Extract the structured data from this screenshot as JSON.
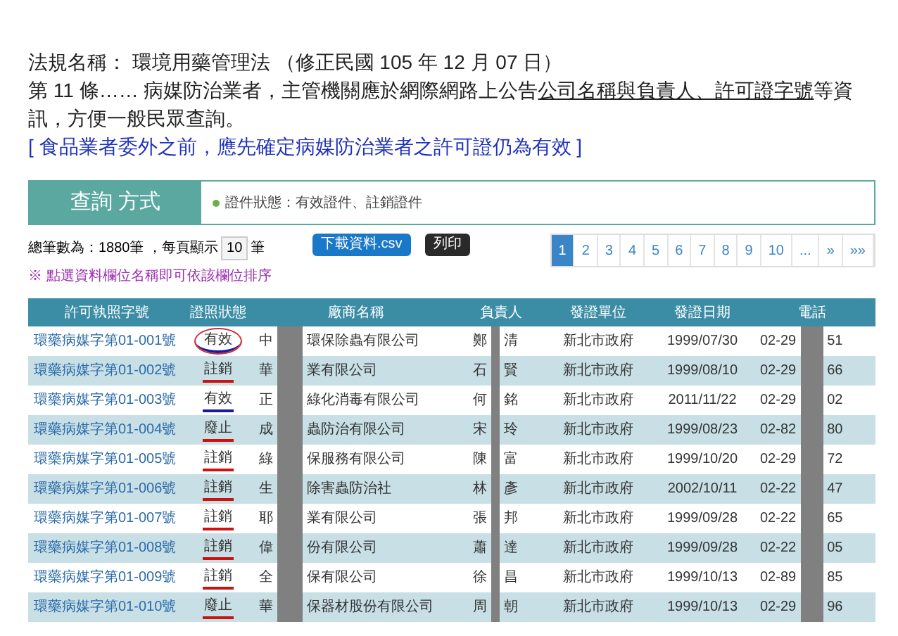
{
  "law_title": "法規名稱： 環境用藥管理法 （修正民國 105 年 12 月 07 日）",
  "article": [
    {
      "text": "第 11 條…… 病媒防治業者，主管機關應於網際網路上公告",
      "underlined": false
    },
    {
      "text": "公司名稱與負責人、許可證字號",
      "underlined": true
    },
    {
      "text": "等資訊，方便一般民眾查詢。",
      "underlined": false
    }
  ],
  "note": "[ 食品業者委外之前，應先確定病媒防治業者之許可證仍為有效 ]",
  "query_panel": {
    "title": "查詢 方式",
    "condition": "證件狀態：有效證件、註銷證件"
  },
  "summary": {
    "count": "總筆數為：1880筆 ，每頁顯示",
    "page_size": "10",
    "unit": "筆"
  },
  "buttons": [
    {
      "label": "下載資料.csv",
      "kind": "primary"
    },
    {
      "label": "列印",
      "kind": "dark"
    }
  ],
  "pagination": [
    {
      "label": "1",
      "selected": true
    },
    {
      "label": "2",
      "selected": false
    },
    {
      "label": "3",
      "selected": false
    },
    {
      "label": "4",
      "selected": false
    },
    {
      "label": "5",
      "selected": false
    },
    {
      "label": "6",
      "selected": false
    },
    {
      "label": "7",
      "selected": false
    },
    {
      "label": "8",
      "selected": false
    },
    {
      "label": "9",
      "selected": false
    },
    {
      "label": "10",
      "selected": false
    },
    {
      "label": "...",
      "selected": false
    },
    {
      "label": "»",
      "selected": false
    },
    {
      "label": "»»",
      "selected": false
    }
  ],
  "sort_hint": "※ 點選資料欄位名稱即可依該欄位排序",
  "table": {
    "columns": [
      "許可執照字號",
      "證照狀態",
      "廠商名稱",
      "負責人",
      "發證單位",
      "發證日期",
      "電話"
    ],
    "rows": [
      {
        "license": "環藥病媒字第01-001號",
        "status": "有效",
        "color": "#1a1aa0",
        "circled": true,
        "company": [
          "中",
          "環保除蟲有限公司"
        ],
        "owner": [
          "鄭",
          "清"
        ],
        "issuer": "新北市政府",
        "date": "1999/07/30",
        "phone": [
          "02-29",
          "51"
        ]
      },
      {
        "license": "環藥病媒字第01-002號",
        "status": "註銷",
        "color": "#cc1111",
        "circled": false,
        "company": [
          "華",
          "業有限公司"
        ],
        "owner": [
          "石",
          "賢"
        ],
        "issuer": "新北市政府",
        "date": "1999/08/10",
        "phone": [
          "02-29",
          "66"
        ]
      },
      {
        "license": "環藥病媒字第01-003號",
        "status": "有效",
        "color": "#1a1aa0",
        "circled": false,
        "company": [
          "正",
          "綠化消毒有限公司"
        ],
        "owner": [
          "何",
          "銘"
        ],
        "issuer": "新北市政府",
        "date": "2011/11/22",
        "phone": [
          "02-29",
          "02"
        ]
      },
      {
        "license": "環藥病媒字第01-004號",
        "status": "廢止",
        "color": "#cc1111",
        "circled": false,
        "company": [
          "成",
          "蟲防治有限公司"
        ],
        "owner": [
          "宋",
          "玲"
        ],
        "issuer": "新北市政府",
        "date": "1999/08/23",
        "phone": [
          "02-82",
          "80"
        ]
      },
      {
        "license": "環藥病媒字第01-005號",
        "status": "註銷",
        "color": "#cc1111",
        "circled": false,
        "company": [
          "綠",
          "保服務有限公司"
        ],
        "owner": [
          "陳",
          "富"
        ],
        "issuer": "新北市政府",
        "date": "1999/10/20",
        "phone": [
          "02-29",
          "72"
        ]
      },
      {
        "license": "環藥病媒字第01-006號",
        "status": "註銷",
        "color": "#cc1111",
        "circled": false,
        "company": [
          "生",
          "除害蟲防治社"
        ],
        "owner": [
          "林",
          "彥"
        ],
        "issuer": "新北市政府",
        "date": "2002/10/11",
        "phone": [
          "02-22",
          "47"
        ]
      },
      {
        "license": "環藥病媒字第01-007號",
        "status": "註銷",
        "color": "#cc1111",
        "circled": false,
        "company": [
          "耶",
          "業有限公司"
        ],
        "owner": [
          "張",
          "邦"
        ],
        "issuer": "新北市政府",
        "date": "1999/09/28",
        "phone": [
          "02-22",
          "65"
        ]
      },
      {
        "license": "環藥病媒字第01-008號",
        "status": "註銷",
        "color": "#cc1111",
        "circled": false,
        "company": [
          "偉",
          "份有限公司"
        ],
        "owner": [
          "蕭",
          "達"
        ],
        "issuer": "新北市政府",
        "date": "1999/09/28",
        "phone": [
          "02-22",
          "05"
        ]
      },
      {
        "license": "環藥病媒字第01-009號",
        "status": "註銷",
        "color": "#cc1111",
        "circled": false,
        "company": [
          "全",
          "保有限公司"
        ],
        "owner": [
          "徐",
          "昌"
        ],
        "issuer": "新北市政府",
        "date": "1999/10/13",
        "phone": [
          "02-89",
          "85"
        ]
      },
      {
        "license": "環藥病媒字第01-010號",
        "status": "廢止",
        "color": "#cc1111",
        "circled": false,
        "company": [
          "華",
          "保器材股份有限公司"
        ],
        "owner": [
          "周",
          "朝"
        ],
        "issuer": "新北市政府",
        "date": "1999/10/13",
        "phone": [
          "02-29",
          "96"
        ]
      }
    ]
  }
}
